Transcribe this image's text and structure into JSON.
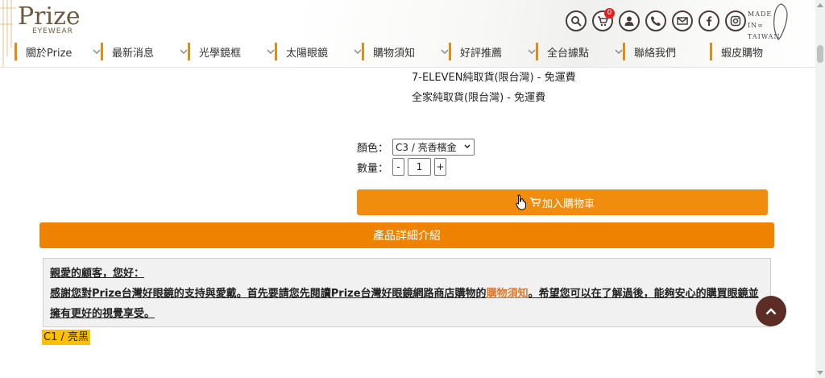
{
  "header": {
    "logo_main": "Prize",
    "logo_sub": "EYEWEAR",
    "cart_count": "0",
    "made_in_line1": "MADE",
    "made_in_line2": "IN",
    "made_in_line3": "TAIWAN",
    "icons": [
      "search-icon",
      "cart-icon",
      "user-icon",
      "phone-icon",
      "mail-icon",
      "facebook-icon",
      "instagram-icon"
    ]
  },
  "nav": {
    "items": [
      {
        "label": "關於Prize",
        "width": 107
      },
      {
        "label": "最新消息",
        "width": 108
      },
      {
        "label": "光學鏡框",
        "width": 108
      },
      {
        "label": "太陽眼鏡",
        "width": 108
      },
      {
        "label": "購物須知",
        "width": 108
      },
      {
        "label": "好評推薦",
        "width": 108
      },
      {
        "label": "全台據點",
        "width": 108
      },
      {
        "label": "聯絡我們",
        "width": 108
      },
      {
        "label": "蝦皮購物",
        "width": 90
      }
    ]
  },
  "shipping": {
    "line1": "7-ELEVEN純取貨(限台灣) - 免運費",
    "line2": "全家純取貨(限台灣) - 免運費"
  },
  "options": {
    "color_label": "顏色：",
    "color_value": "C3 / 亮香檳金",
    "qty_label": "數量：",
    "qty_minus": "-",
    "qty_value": "1",
    "qty_plus": "+"
  },
  "buttons": {
    "add_cart": "加入購物車",
    "detail": "產品詳細介紹"
  },
  "notice": {
    "greeting": "親愛的顧客，您好：",
    "text_before": "感謝您對Prize台灣好眼鏡的支持與愛戴。首先要請您先閱讀Prize台灣好眼鏡網路商店購物的",
    "link": "購物須知",
    "text_after": "。希望您可以在了解過後，能夠安心的購買眼鏡並擁有更好的視覺享受。"
  },
  "variant_label": "C1 / 亮黑",
  "colors": {
    "accent": "#ef8300",
    "nav_border": "#e58a13",
    "back_top": "#5b2d24",
    "variant_bg": "#ffc000"
  }
}
